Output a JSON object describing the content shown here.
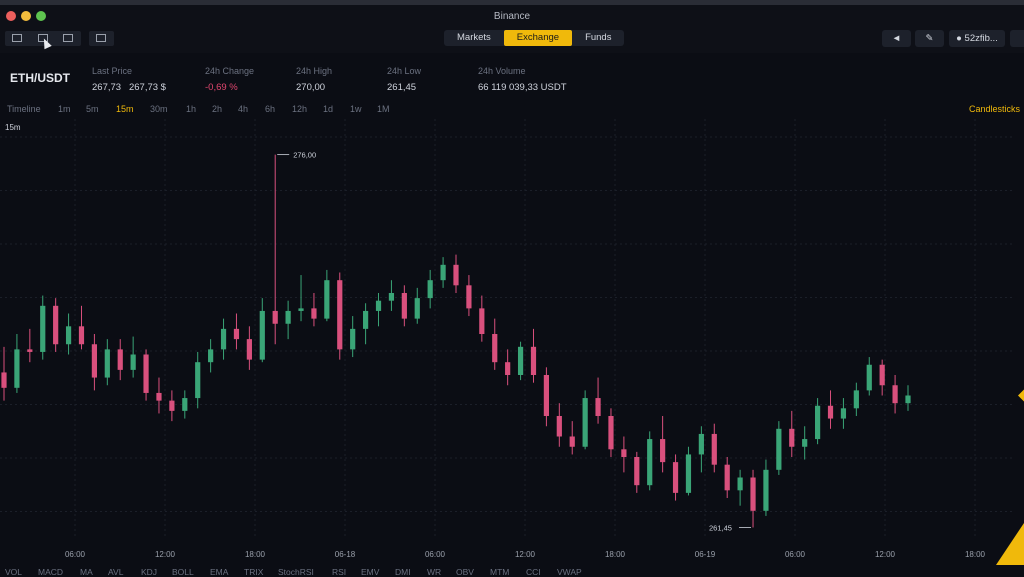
{
  "window": {
    "title": "Binance"
  },
  "nav": {
    "tabs": [
      {
        "label": "Markets",
        "active": false
      },
      {
        "label": "Exchange",
        "active": true
      },
      {
        "label": "Funds",
        "active": false
      }
    ],
    "user_label": "52zfib..."
  },
  "ticker": {
    "pair": "ETH/USDT",
    "last_price_label": "Last Price",
    "last_price": "267,73",
    "last_price_usd": "267,73 $",
    "change_label": "24h Change",
    "change": "-0,69 %",
    "high_label": "24h High",
    "high": "270,00",
    "low_label": "24h Low",
    "low": "261,45",
    "volume_label": "24h Volume",
    "volume": "66 119 039,33 USDT"
  },
  "intervals": [
    "Timeline",
    "1m",
    "5m",
    "15m",
    "30m",
    "1h",
    "2h",
    "4h",
    "6h",
    "12h",
    "1d",
    "1w",
    "1M"
  ],
  "active_interval": "15m",
  "chart_type_label": "Candlesticks",
  "chart_data": {
    "type": "candlestick",
    "interval_label": "15m",
    "x_ticks": [
      "06:00",
      "12:00",
      "18:00",
      "06-18",
      "06:00",
      "12:00",
      "18:00",
      "06-19",
      "06:00",
      "12:00",
      "18:00"
    ],
    "high_marker": "276,00",
    "low_marker": "261,45",
    "ylim": [
      261,
      277
    ],
    "colors": {
      "up": "#3aa577",
      "down": "#d9507d",
      "accent": "#f0b90b",
      "grid": "#1b1f29",
      "axis_text": "#9aa0ab"
    },
    "series": [
      {
        "name": "",
        "ohlc": [
          [
            267.5,
            268.5,
            266.4,
            266.9
          ],
          [
            266.9,
            269.0,
            266.7,
            268.4
          ],
          [
            268.4,
            269.2,
            267.9,
            268.3
          ],
          [
            268.3,
            270.5,
            268.0,
            270.1
          ],
          [
            270.1,
            270.4,
            268.3,
            268.6
          ],
          [
            268.6,
            269.8,
            268.2,
            269.3
          ],
          [
            269.3,
            270.1,
            268.4,
            268.6
          ],
          [
            268.6,
            269.0,
            266.8,
            267.3
          ],
          [
            267.3,
            268.8,
            267.0,
            268.4
          ],
          [
            268.4,
            268.8,
            267.2,
            267.6
          ],
          [
            267.6,
            268.9,
            267.3,
            268.2
          ],
          [
            268.2,
            268.4,
            266.4,
            266.7
          ],
          [
            266.7,
            267.3,
            265.9,
            266.4
          ],
          [
            266.4,
            266.8,
            265.6,
            266.0
          ],
          [
            266.0,
            266.8,
            265.7,
            266.5
          ],
          [
            266.5,
            268.3,
            266.1,
            267.9
          ],
          [
            267.9,
            268.8,
            267.5,
            268.4
          ],
          [
            268.4,
            269.6,
            268.0,
            269.2
          ],
          [
            269.2,
            269.8,
            268.4,
            268.8
          ],
          [
            268.8,
            269.3,
            267.6,
            268.0
          ],
          [
            268.0,
            270.4,
            267.9,
            269.9
          ],
          [
            269.9,
            276.0,
            268.6,
            269.4
          ],
          [
            269.4,
            270.3,
            268.8,
            269.9
          ],
          [
            269.9,
            271.3,
            269.5,
            270.0
          ],
          [
            270.0,
            270.6,
            269.3,
            269.6
          ],
          [
            269.6,
            271.5,
            269.5,
            271.1
          ],
          [
            271.1,
            271.4,
            268.0,
            268.4
          ],
          [
            268.4,
            269.7,
            268.1,
            269.2
          ],
          [
            269.2,
            270.2,
            268.6,
            269.9
          ],
          [
            269.9,
            270.6,
            269.3,
            270.3
          ],
          [
            270.3,
            271.1,
            269.9,
            270.6
          ],
          [
            270.6,
            270.9,
            269.3,
            269.6
          ],
          [
            269.6,
            270.8,
            269.4,
            270.4
          ],
          [
            270.4,
            271.5,
            270.0,
            271.1
          ],
          [
            271.1,
            272.0,
            270.8,
            271.7
          ],
          [
            271.7,
            272.1,
            270.6,
            270.9
          ],
          [
            270.9,
            271.3,
            269.7,
            270.0
          ],
          [
            270.0,
            270.5,
            268.7,
            269.0
          ],
          [
            269.0,
            269.6,
            267.6,
            267.9
          ],
          [
            267.9,
            268.4,
            267.0,
            267.4
          ],
          [
            267.4,
            268.7,
            267.2,
            268.5
          ],
          [
            268.5,
            269.2,
            267.1,
            267.4
          ],
          [
            267.4,
            267.7,
            265.4,
            265.8
          ],
          [
            265.8,
            266.3,
            264.6,
            265.0
          ],
          [
            265.0,
            265.6,
            264.3,
            264.6
          ],
          [
            264.6,
            266.8,
            264.5,
            266.5
          ],
          [
            266.5,
            267.3,
            265.5,
            265.8
          ],
          [
            265.8,
            266.1,
            264.2,
            264.5
          ],
          [
            264.5,
            265.0,
            263.6,
            264.2
          ],
          [
            264.2,
            264.4,
            262.8,
            263.1
          ],
          [
            263.1,
            265.2,
            262.9,
            264.9
          ],
          [
            264.9,
            265.8,
            263.6,
            264.0
          ],
          [
            264.0,
            264.3,
            262.5,
            262.8
          ],
          [
            262.8,
            264.6,
            262.7,
            264.3
          ],
          [
            264.3,
            265.4,
            263.6,
            265.1
          ],
          [
            265.1,
            265.5,
            263.6,
            263.9
          ],
          [
            263.9,
            264.2,
            262.6,
            262.9
          ],
          [
            262.9,
            263.7,
            262.3,
            263.4
          ],
          [
            263.4,
            263.7,
            261.45,
            262.1
          ],
          [
            262.1,
            264.1,
            261.9,
            263.7
          ],
          [
            263.7,
            265.6,
            263.5,
            265.3
          ],
          [
            265.3,
            266.0,
            264.2,
            264.6
          ],
          [
            264.6,
            265.4,
            264.1,
            264.9
          ],
          [
            264.9,
            266.5,
            264.7,
            266.2
          ],
          [
            266.2,
            266.8,
            265.3,
            265.7
          ],
          [
            265.7,
            266.5,
            265.3,
            266.1
          ],
          [
            266.1,
            267.1,
            265.8,
            266.8
          ],
          [
            266.8,
            268.1,
            266.6,
            267.8
          ],
          [
            267.8,
            268.0,
            266.6,
            267.0
          ],
          [
            267.0,
            267.4,
            265.9,
            266.3
          ],
          [
            266.3,
            267.0,
            266.0,
            266.6
          ]
        ]
      }
    ]
  },
  "indicators": [
    "VOL",
    "MACD",
    "MA",
    "AVL",
    "KDJ",
    "BOLL",
    "EMA",
    "TRIX",
    "StochRSI",
    "RSI",
    "EMV",
    "DMI",
    "WR",
    "OBV",
    "MTM",
    "CCI",
    "VWAP"
  ]
}
